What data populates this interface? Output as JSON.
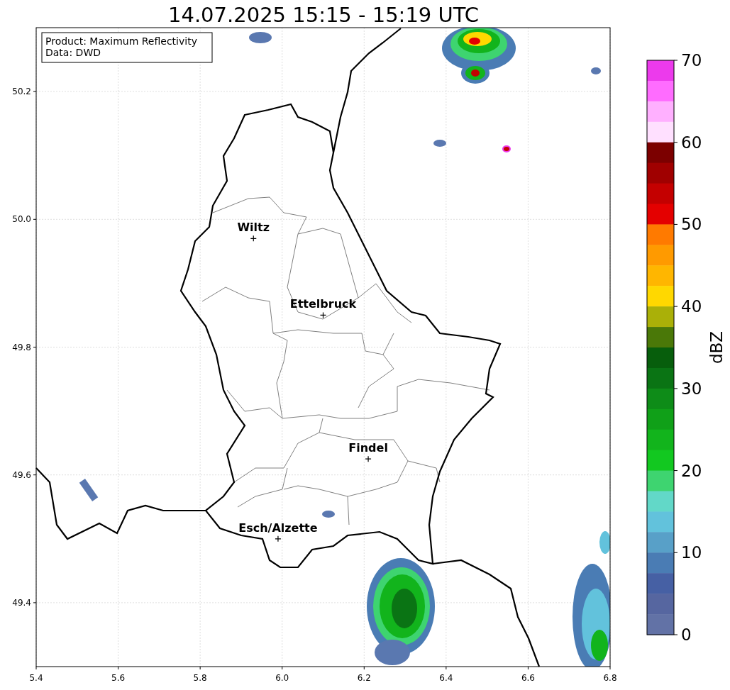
{
  "title": "14.07.2025 15:15 - 15:19 UTC",
  "info_box": {
    "lines": [
      "Product: Maximum Reflectivity",
      "Data: DWD"
    ]
  },
  "map": {
    "chart_data": {
      "type": "scatter",
      "grid": true,
      "xlim": [
        5.4,
        6.8
      ],
      "ylim": [
        49.3,
        50.3
      ],
      "xticks": [
        {
          "value": 5.4,
          "label": "5.4"
        },
        {
          "value": 5.6,
          "label": "5.6"
        },
        {
          "value": 5.8,
          "label": "5.8"
        },
        {
          "value": 6.0,
          "label": "6.0"
        },
        {
          "value": 6.2,
          "label": "6.2"
        },
        {
          "value": 6.4,
          "label": "6.4"
        },
        {
          "value": 6.6,
          "label": "6.6"
        },
        {
          "value": 6.8,
          "label": "6.8"
        }
      ],
      "yticks": [
        {
          "value": 49.4,
          "label": "49.4"
        },
        {
          "value": 49.6,
          "label": "49.6"
        },
        {
          "value": 49.8,
          "label": "49.8"
        },
        {
          "value": 50.0,
          "label": "50.0"
        },
        {
          "value": 50.2,
          "label": "50.2"
        }
      ],
      "x": [
        5.93,
        6.1,
        6.21,
        5.99
      ],
      "series": [
        {
          "color": "#000000",
          "values": [
            49.97,
            49.85,
            49.625,
            49.5
          ]
        }
      ],
      "annotations": [
        {
          "x": 5.93,
          "y": 49.97,
          "text": "Wiltz"
        },
        {
          "x": 6.1,
          "y": 49.85,
          "text": "Ettelbruck"
        },
        {
          "x": 6.21,
          "y": 49.625,
          "text": "Findel"
        },
        {
          "x": 5.99,
          "y": 49.5,
          "text": "Esch/Alzette"
        }
      ]
    }
  },
  "colorbar": {
    "label": "dBZ",
    "ticks": [
      "70",
      "60",
      "50",
      "40",
      "30",
      "20",
      "10",
      "0"
    ],
    "bands": [
      {
        "color": "#ec3aec"
      },
      {
        "color": "#ff6cff"
      },
      {
        "color": "#ffb0ff"
      },
      {
        "color": "#ffe0ff"
      },
      {
        "color": "#7c0000"
      },
      {
        "color": "#a00000"
      },
      {
        "color": "#c40000"
      },
      {
        "color": "#e40000"
      },
      {
        "color": "#ff7a00"
      },
      {
        "color": "#ff9a00"
      },
      {
        "color": "#ffb600"
      },
      {
        "color": "#ffd800"
      },
      {
        "color": "#aab008"
      },
      {
        "color": "#4a7808"
      },
      {
        "color": "#075e0c"
      },
      {
        "color": "#0a7414"
      },
      {
        "color": "#0e8c18"
      },
      {
        "color": "#10a018"
      },
      {
        "color": "#12b41c"
      },
      {
        "color": "#12c820"
      },
      {
        "color": "#3ed470"
      },
      {
        "color": "#62d8c8"
      },
      {
        "color": "#62c2dc"
      },
      {
        "color": "#58a0c8"
      },
      {
        "color": "#4a7cb4"
      },
      {
        "color": "#4660a4"
      },
      {
        "color": "#5666a0"
      },
      {
        "color": "#6272a6"
      }
    ]
  }
}
